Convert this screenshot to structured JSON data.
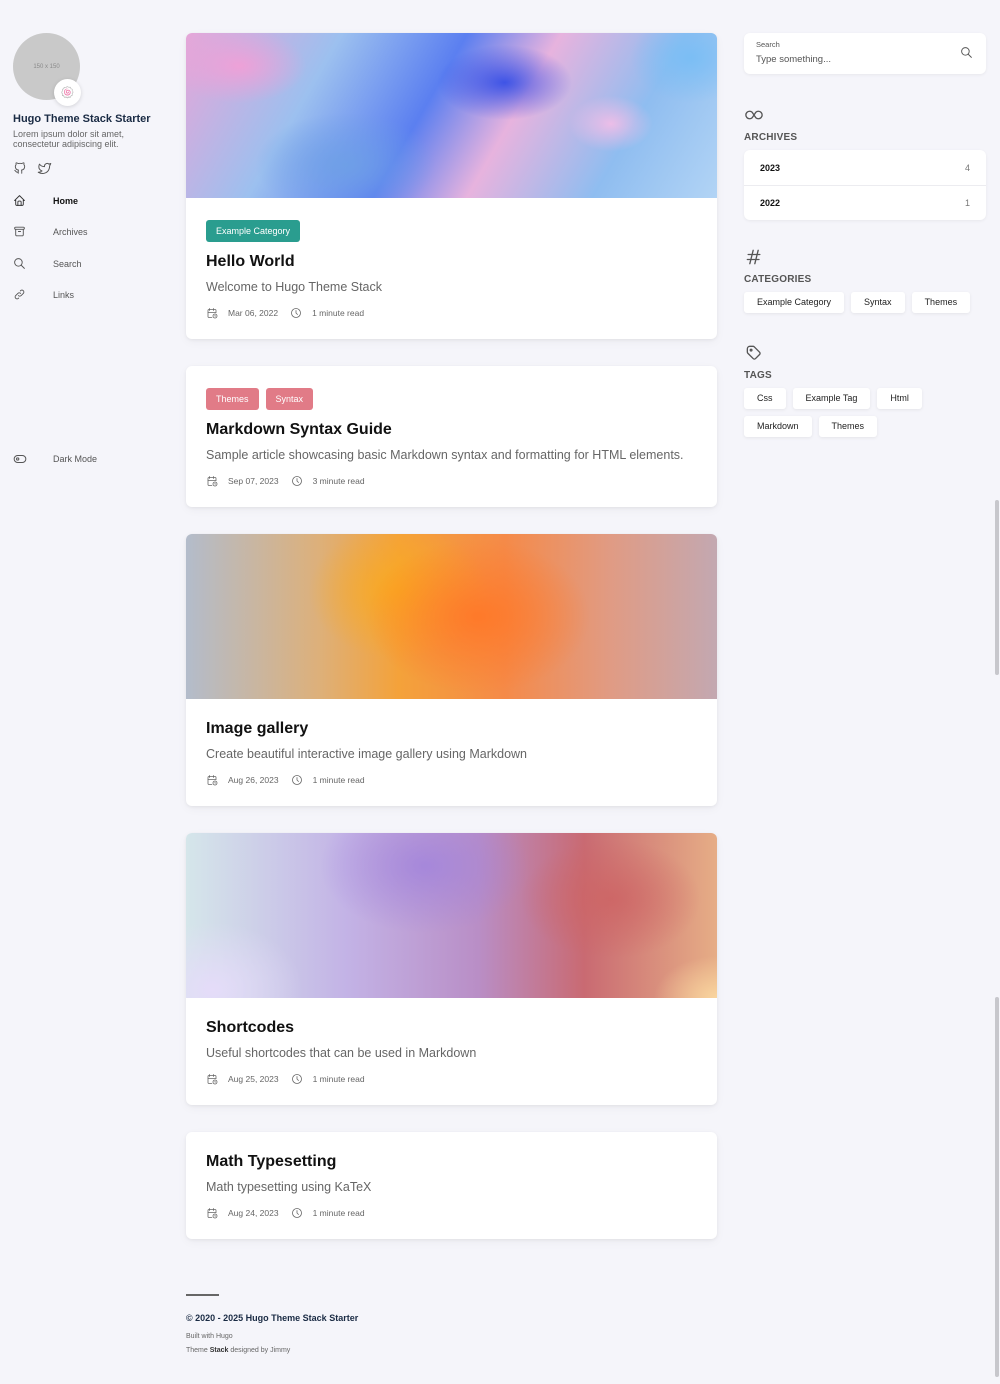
{
  "sidebar": {
    "avatar_text": "150 x 150",
    "emoji": "🍥",
    "site_name": "Hugo Theme Stack Starter",
    "site_description": "Lorem ipsum dolor sit amet, consectetur adipiscing elit.",
    "social": [
      "github-icon",
      "twitter-icon"
    ],
    "menu": [
      {
        "label": "Home",
        "icon": "home-icon",
        "active": true
      },
      {
        "label": "Archives",
        "icon": "archive-icon",
        "active": false
      },
      {
        "label": "Search",
        "icon": "search-icon",
        "active": false
      },
      {
        "label": "Links",
        "icon": "link-icon",
        "active": false
      }
    ],
    "dark_mode_label": "Dark Mode"
  },
  "posts": [
    {
      "categories": [
        "Example Category"
      ],
      "title": "Hello World",
      "subtitle": "Welcome to Hugo Theme Stack",
      "date": "Mar 06, 2022",
      "reading_time": "1 minute read",
      "has_image": true
    },
    {
      "categories": [
        "Themes",
        "Syntax"
      ],
      "title": "Markdown Syntax Guide",
      "subtitle": "Sample article showcasing basic Markdown syntax and formatting for HTML elements.",
      "date": "Sep 07, 2023",
      "reading_time": "3 minute read",
      "has_image": false
    },
    {
      "categories": [],
      "title": "Image gallery",
      "subtitle": "Create beautiful interactive image gallery using Markdown",
      "date": "Aug 26, 2023",
      "reading_time": "1 minute read",
      "has_image": true
    },
    {
      "categories": [],
      "title": "Shortcodes",
      "subtitle": "Useful shortcodes that can be used in Markdown",
      "date": "Aug 25, 2023",
      "reading_time": "1 minute read",
      "has_image": true
    },
    {
      "categories": [],
      "title": "Math Typesetting",
      "subtitle": "Math typesetting using KaTeX",
      "date": "Aug 24, 2023",
      "reading_time": "1 minute read",
      "has_image": false
    }
  ],
  "footer": {
    "copyright": "© 2020 - 2025 Hugo Theme Stack Starter",
    "built_with": "Built with Hugo",
    "theme_prefix": "Theme ",
    "theme_name": "Stack",
    "theme_suffix": " designed by Jimmy"
  },
  "search": {
    "label": "Search",
    "placeholder": "Type something..."
  },
  "archives": {
    "heading": "ARCHIVES",
    "icon": "infinity-icon",
    "items": [
      {
        "year": "2023",
        "count": "4"
      },
      {
        "year": "2022",
        "count": "1"
      }
    ]
  },
  "categories": {
    "heading": "CATEGORIES",
    "icon": "hash-icon",
    "items": [
      "Example Category",
      "Syntax",
      "Themes"
    ]
  },
  "tags": {
    "heading": "TAGS",
    "icon": "tag-icon",
    "items": [
      "Css",
      "Example Tag",
      "Html",
      "Markdown",
      "Themes"
    ]
  },
  "colors": {
    "category_green": "#2a9d8f",
    "category_pink": "#e17b87",
    "background": "#f5f5fa"
  }
}
